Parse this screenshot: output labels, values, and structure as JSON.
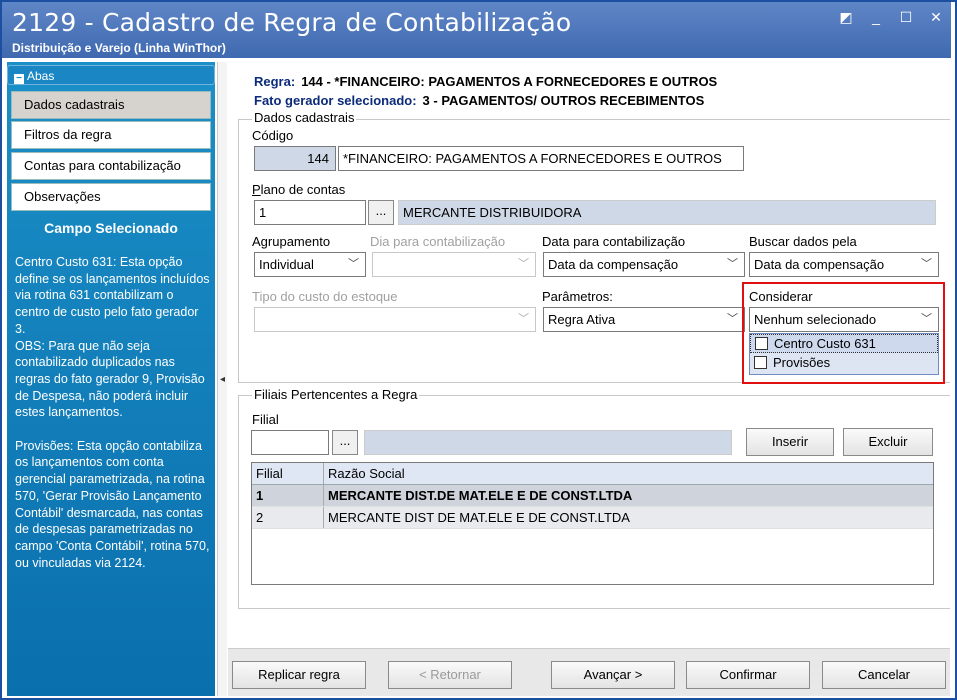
{
  "window": {
    "title": "2129 - Cadastro de Regra de Contabilização",
    "subtitle": "Distribuição e Varejo (Linha WinThor)"
  },
  "sidebar": {
    "abas_label": "Abas",
    "items": [
      {
        "label": "Dados cadastrais"
      },
      {
        "label": "Filtros da regra"
      },
      {
        "label": "Contas para contabilização"
      },
      {
        "label": "Observações"
      }
    ],
    "campo_title": "Campo Selecionado",
    "campo_text": "Centro Custo 631: Esta opção define se os lançamentos incluídos via rotina 631 contabilizam o centro de custo pelo fato gerador 3.\nOBS: Para que não seja contabilizado duplicados nas regras do fato gerador 9, Provisão de Despesa, não poderá incluir estes lançamentos.\n\nProvisões: Esta opção contabiliza os lançamentos com conta gerencial parametrizada, na rotina 570, 'Gerar Provisão Lançamento Contábil' desmarcada, nas contas de despesas parametrizadas no campo 'Conta Contábil', rotina 570, ou vinculadas via 2124."
  },
  "header": {
    "regra_label": "Regra:",
    "regra_value": "144 - *FINANCEIRO: PAGAMENTOS A FORNECEDORES E OUTROS",
    "fato_label": "Fato gerador selecionado:",
    "fato_value": "3 - PAGAMENTOS/ OUTROS RECEBIMENTOS"
  },
  "form": {
    "group_label": "Dados cadastrais",
    "codigo_label": "Código",
    "codigo_value": "144",
    "descricao_value": "*FINANCEIRO: PAGAMENTOS A FORNECEDORES E OUTROS",
    "plano_label": "Plano de contas",
    "plano_value": "1",
    "plano_desc": "MERCANTE DISTRIBUIDORA",
    "dots": "...",
    "agrupamento_label": "Agrupamento",
    "agrupamento_value": "Individual",
    "dia_label": "Dia para contabilização",
    "dia_value": "",
    "data_label": "Data para contabilização",
    "data_value": "Data da compensação",
    "buscar_label": "Buscar dados pela",
    "buscar_value": "Data da compensação",
    "tipo_label": "Tipo do custo do estoque",
    "tipo_value": "",
    "parametros_label": "Parâmetros:",
    "parametros_value": "Regra Ativa",
    "considerar_label": "Considerar",
    "considerar_value": "Nenhum selecionado",
    "considerar_options": [
      "Centro Custo 631",
      "Provisões"
    ]
  },
  "filiais": {
    "group_label": "Filiais Pertencentes a Regra",
    "filial_label": "Filial",
    "filial_value": "",
    "inserir": "Inserir",
    "excluir": "Excluir",
    "columns": [
      "Filial",
      "Razão Social"
    ],
    "rows": [
      {
        "filial": "1",
        "razao": "MERCANTE DIST.DE MAT.ELE E DE CONST.LTDA"
      },
      {
        "filial": "2",
        "razao": "MERCANTE DIST DE MAT.ELE E DE CONST.LTDA"
      }
    ]
  },
  "footer": {
    "replicar": "Replicar regra",
    "retornar": "< Retornar",
    "avancar": "Avançar >",
    "confirmar": "Confirmar",
    "cancelar": "Cancelar"
  },
  "colors": {
    "titlebar": "#4a74b9",
    "sidebar": "#0a7fbf",
    "highlight": "#e01010"
  }
}
